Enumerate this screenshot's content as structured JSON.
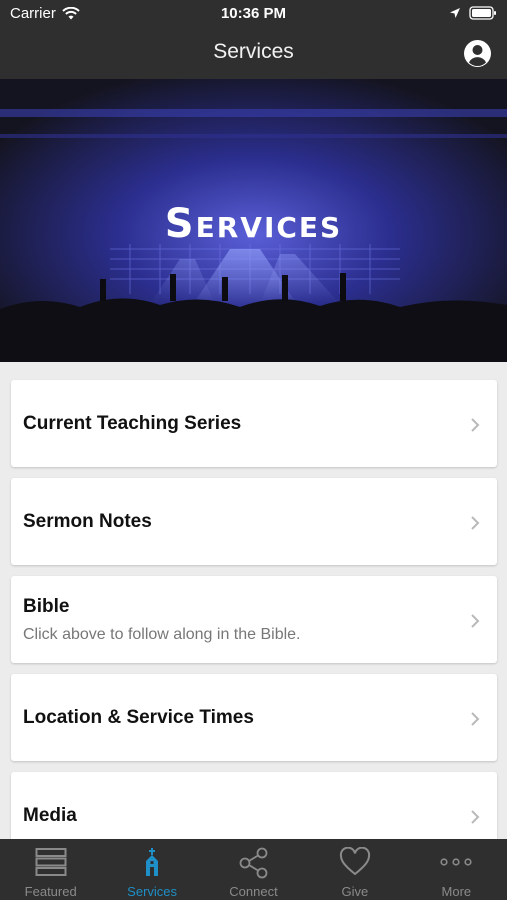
{
  "status_bar": {
    "carrier": "Carrier",
    "time": "10:36 PM"
  },
  "nav": {
    "title": "Services"
  },
  "hero": {
    "title": "Services"
  },
  "list": [
    {
      "label": "Current Teaching Series",
      "sub": ""
    },
    {
      "label": "Sermon Notes",
      "sub": ""
    },
    {
      "label": "Bible",
      "sub": "Click above to follow along in the Bible."
    },
    {
      "label": "Location & Service Times",
      "sub": ""
    },
    {
      "label": "Media",
      "sub": ""
    }
  ],
  "tabs": [
    {
      "label": "Featured",
      "icon": "featured-icon"
    },
    {
      "label": "Services",
      "icon": "church-icon",
      "active": true
    },
    {
      "label": "Connect",
      "icon": "share-icon"
    },
    {
      "label": "Give",
      "icon": "heart-icon"
    },
    {
      "label": "More",
      "icon": "more-icon"
    }
  ],
  "colors": {
    "bar": "#2f2f2f",
    "accent": "#1e8fc7",
    "background": "#ececec"
  }
}
